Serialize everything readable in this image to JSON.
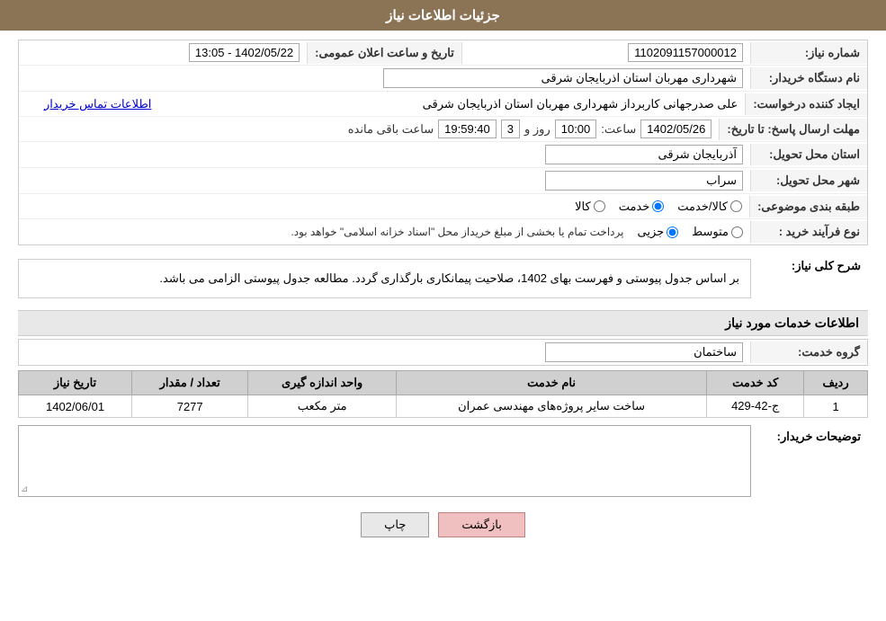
{
  "header": {
    "title": "جزئیات اطلاعات نیاز"
  },
  "form": {
    "need_number_label": "شماره نیاز:",
    "need_number_value": "1102091157000012",
    "announcement_date_label": "تاریخ و ساعت اعلان عمومی:",
    "announcement_date_value": "1402/05/22 - 13:05",
    "buyer_org_label": "نام دستگاه خریدار:",
    "buyer_org_value": "شهرداری مهربان استان اذربایجان شرقی",
    "requester_label": "ایجاد کننده درخواست:",
    "requester_value": "علی  صدرجهانی  کاربرداز شهرداری مهربان استان اذربایجان شرقی",
    "contact_link": "اطلاعات تماس خریدار",
    "response_deadline_label": "مهلت ارسال پاسخ: تا تاریخ:",
    "response_date": "1402/05/26",
    "response_time_label": "ساعت:",
    "response_time": "10:00",
    "response_days_label": "روز و",
    "response_days": "3",
    "response_remaining_label": "ساعت باقی مانده",
    "response_remaining": "19:59:40",
    "delivery_province_label": "استان محل تحویل:",
    "delivery_province_value": "آذربایجان شرقی",
    "delivery_city_label": "شهر محل تحویل:",
    "delivery_city_value": "سراب",
    "category_label": "طبقه بندی موضوعی:",
    "category_kala": "کالا",
    "category_khedmat": "خدمت",
    "category_kala_khedmat": "کالا/خدمت",
    "category_selected": "khedmat",
    "process_label": "نوع فرآیند خرید :",
    "process_jazii": "جزیی",
    "process_motavasset": "متوسط",
    "process_note": "پرداخت تمام یا بخشی از مبلغ خریداز محل \"اسناد خزانه اسلامی\" خواهد بود.",
    "process_selected": "jazii",
    "description_label": "شرح کلی نیاز:",
    "description_text": "بر اساس جدول پیوستی و فهرست بهای 1402، صلاحیت پیمانکاری بارگذاری گردد. مطالعه جدول پیوستی الزامی می باشد.",
    "services_section_label": "اطلاعات خدمات مورد نیاز",
    "service_group_label": "گروه خدمت:",
    "service_group_value": "ساختمان",
    "table": {
      "col_row": "ردیف",
      "col_code": "کد خدمت",
      "col_name": "نام خدمت",
      "col_unit": "واحد اندازه گیری",
      "col_qty": "تعداد / مقدار",
      "col_date": "تاریخ نیاز",
      "rows": [
        {
          "row": "1",
          "code": "ج-42-429",
          "name": "ساخت سایر پروژه‌های مهندسی عمران",
          "unit": "متر مکعب",
          "qty": "7277",
          "date": "1402/06/01"
        }
      ]
    },
    "buyer_notes_label": "توضیحات خریدار:",
    "buyer_notes_value": ""
  },
  "buttons": {
    "print": "چاپ",
    "back": "بازگشت"
  },
  "col_detection": "Col"
}
